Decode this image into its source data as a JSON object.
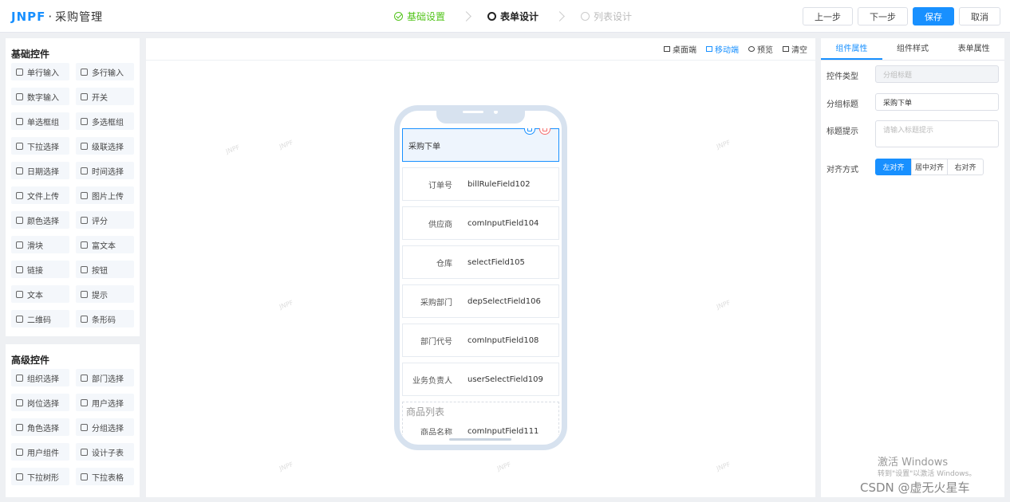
{
  "header": {
    "logo": "JNPF",
    "separator": "·",
    "app_name": "采购管理",
    "steps": [
      "基础设置",
      "表单设计",
      "列表设计"
    ],
    "buttons": {
      "prev": "上一步",
      "next": "下一步",
      "save": "保存",
      "cancel": "取消"
    }
  },
  "basic_controls": {
    "title": "基础控件",
    "items": [
      "单行输入",
      "多行输入",
      "数字输入",
      "开关",
      "单选框组",
      "多选框组",
      "下拉选择",
      "级联选择",
      "日期选择",
      "时间选择",
      "文件上传",
      "图片上传",
      "颜色选择",
      "评分",
      "滑块",
      "富文本",
      "链接",
      "按钮",
      "文本",
      "提示",
      "二维码",
      "条形码"
    ]
  },
  "advanced_controls": {
    "title": "高级控件",
    "items": [
      "组织选择",
      "部门选择",
      "岗位选择",
      "用户选择",
      "角色选择",
      "分组选择",
      "用户组件",
      "设计子表",
      "下拉树形",
      "下拉表格"
    ]
  },
  "canvas_toolbar": {
    "desktop": "桌面端",
    "mobile": "移动端",
    "preview": "预览",
    "clear": "清空"
  },
  "watermark": "JNPF",
  "form": {
    "group_title": "采购下单",
    "fields": [
      {
        "label": "订单号",
        "value": "billRuleField102"
      },
      {
        "label": "供应商",
        "value": "comInputField104"
      },
      {
        "label": "仓库",
        "value": "selectField105"
      },
      {
        "label": "采购部门",
        "value": "depSelectField106"
      },
      {
        "label": "部门代号",
        "value": "comInputField108"
      },
      {
        "label": "业务负责人",
        "value": "userSelectField109"
      }
    ],
    "sublist": {
      "title": "商品列表",
      "label": "商品名称",
      "value": "comInputField111"
    }
  },
  "properties": {
    "tabs": [
      "组件属性",
      "组件样式",
      "表单属性"
    ],
    "control_type_label": "控件类型",
    "control_type_value": "分组标题",
    "group_title_label": "分组标题",
    "group_title_value": "采购下单",
    "hint_label": "标题提示",
    "hint_placeholder": "请输入标题提示",
    "align_label": "对齐方式",
    "align_options": [
      "左对齐",
      "居中对齐",
      "右对齐"
    ]
  },
  "overlay": {
    "windows_activate": "激活 Windows",
    "windows_hint": "转到\"设置\"以激活 Windows。",
    "csdn": "CSDN @虚无火星车"
  },
  "colors": {
    "accent": "#1890ff",
    "success": "#52c41a",
    "danger": "#f56c6c"
  }
}
